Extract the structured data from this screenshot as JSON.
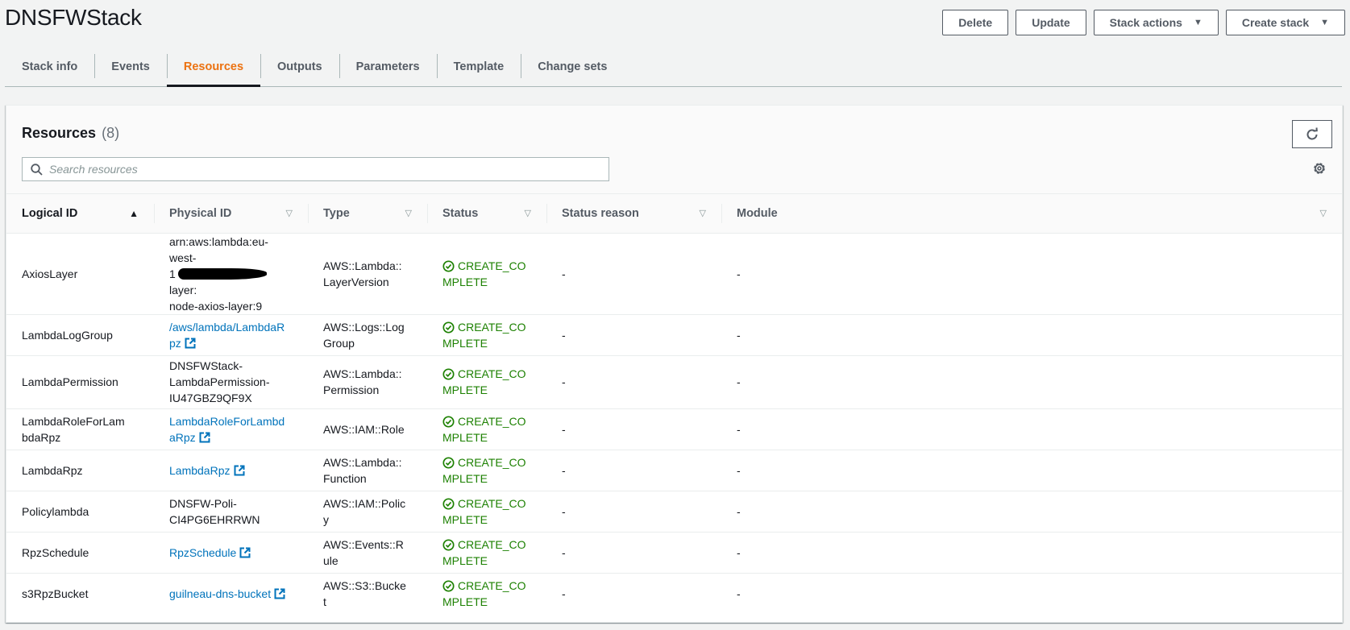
{
  "page": {
    "title": "DNSFWStack"
  },
  "header_actions": {
    "delete": "Delete",
    "update": "Update",
    "stack_actions": "Stack actions",
    "create_stack": "Create stack"
  },
  "tabs": [
    {
      "label": "Stack info",
      "active": false
    },
    {
      "label": "Events",
      "active": false
    },
    {
      "label": "Resources",
      "active": true
    },
    {
      "label": "Outputs",
      "active": false
    },
    {
      "label": "Parameters",
      "active": false
    },
    {
      "label": "Template",
      "active": false
    },
    {
      "label": "Change sets",
      "active": false
    }
  ],
  "resources": {
    "title": "Resources",
    "count": "(8)",
    "search_placeholder": "Search resources",
    "search_value": "",
    "columns": [
      {
        "label": "Logical ID",
        "sort": "ascending"
      },
      {
        "label": "Physical ID",
        "sort": "none"
      },
      {
        "label": "Type",
        "sort": "none"
      },
      {
        "label": "Status",
        "sort": "none"
      },
      {
        "label": "Status reason",
        "sort": "none"
      },
      {
        "label": "Module",
        "sort": "none"
      }
    ],
    "rows": [
      {
        "logical_id": "AxiosLayer",
        "physical_id_prefix": "arn:aws:lambda:eu-west-1",
        "physical_id_redacted": true,
        "physical_id_suffix": "layer:node-axios-layer:9",
        "physical_link": false,
        "type": "AWS::Lambda::LayerVersion",
        "status": "CREATE_COMPLETE",
        "status_reason": "-",
        "module": "-"
      },
      {
        "logical_id": "LambdaLogGroup",
        "physical_id": "/aws/lambda/LambdaRpz",
        "physical_link": true,
        "type": "AWS::Logs::LogGroup",
        "status": "CREATE_COMPLETE",
        "status_reason": "-",
        "module": "-"
      },
      {
        "logical_id": "LambdaPermission",
        "physical_id": "DNSFWStack-LambdaPermission-IU47GBZ9QF9X",
        "physical_link": false,
        "type": "AWS::Lambda::Permission",
        "status": "CREATE_COMPLETE",
        "status_reason": "-",
        "module": "-"
      },
      {
        "logical_id": "LambdaRoleForLambdaRpz",
        "physical_id": "LambdaRoleForLambdaRpz",
        "physical_link": true,
        "type": "AWS::IAM::Role",
        "status": "CREATE_COMPLETE",
        "status_reason": "-",
        "module": "-"
      },
      {
        "logical_id": "LambdaRpz",
        "physical_id": "LambdaRpz",
        "physical_link": true,
        "type": "AWS::Lambda::Function",
        "status": "CREATE_COMPLETE",
        "status_reason": "-",
        "module": "-"
      },
      {
        "logical_id": "Policylambda",
        "physical_id": "DNSFW-Poli-CI4PG6EHRRWN",
        "physical_link": false,
        "type": "AWS::IAM::Policy",
        "status": "CREATE_COMPLETE",
        "status_reason": "-",
        "module": "-"
      },
      {
        "logical_id": "RpzSchedule",
        "physical_id": "RpzSchedule",
        "physical_link": true,
        "type": "AWS::Events::Rule",
        "status": "CREATE_COMPLETE",
        "status_reason": "-",
        "module": "-"
      },
      {
        "logical_id": "s3RpzBucket",
        "physical_id": "guilneau-dns-bucket",
        "physical_link": true,
        "type": "AWS::S3::Bucket",
        "status": "CREATE_COMPLETE",
        "status_reason": "-",
        "module": "-"
      }
    ]
  },
  "colors": {
    "accent_active_tab": "#ec7211",
    "link": "#0073bb",
    "status_success": "#1d8102"
  },
  "icons": {
    "caret": "caret-down-icon",
    "refresh": "refresh-icon",
    "settings": "gear-icon",
    "search": "search-icon",
    "external": "external-link-icon",
    "status_ok": "check-circle-icon",
    "sort_asc": "sort-ascending-icon",
    "sort_none": "sort-icon"
  }
}
